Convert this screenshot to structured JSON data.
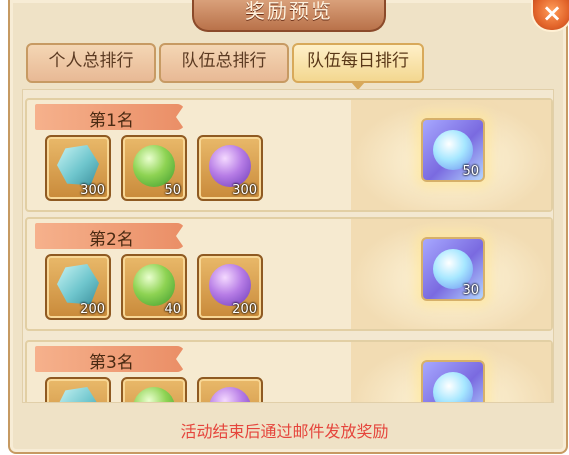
{
  "header": {
    "title": "奖励预览",
    "close_label": "×"
  },
  "tabs": [
    {
      "label": "个人总排行",
      "active": false
    },
    {
      "label": "队伍总排行",
      "active": false
    },
    {
      "label": "队伍每日排行",
      "active": true
    }
  ],
  "ranks": [
    {
      "label": "第1名",
      "rewards": [
        {
          "icon": "crystal-icon",
          "count": "300"
        },
        {
          "icon": "green-orb-icon",
          "count": "50"
        },
        {
          "icon": "purple-orb-icon",
          "count": "300"
        }
      ],
      "big_reward": {
        "icon": "blue-orb-frame-icon",
        "count": "50"
      }
    },
    {
      "label": "第2名",
      "rewards": [
        {
          "icon": "crystal-icon",
          "count": "200"
        },
        {
          "icon": "green-orb-icon",
          "count": "40"
        },
        {
          "icon": "purple-orb-icon",
          "count": "200"
        }
      ],
      "big_reward": {
        "icon": "blue-orb-frame-icon",
        "count": "30"
      }
    },
    {
      "label": "第3名",
      "rewards": [
        {
          "icon": "crystal-icon",
          "count": ""
        },
        {
          "icon": "green-orb-icon",
          "count": ""
        },
        {
          "icon": "purple-orb-icon",
          "count": ""
        }
      ],
      "big_reward": {
        "icon": "blue-orb-frame-icon",
        "count": ""
      }
    }
  ],
  "footer_note": "活动结束后通过邮件发放奖励",
  "colors": {
    "accent": "#e5453c",
    "panel_bg": "#efe2c6"
  }
}
